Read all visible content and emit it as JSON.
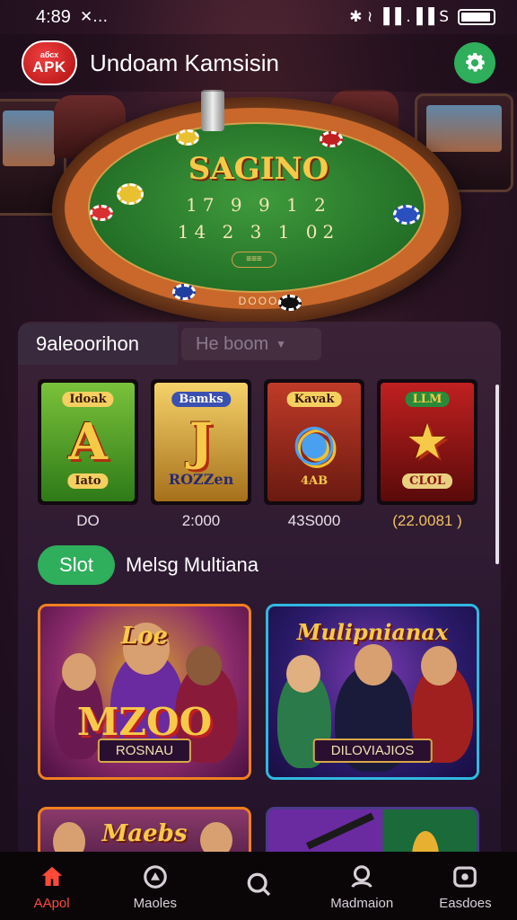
{
  "status_bar": {
    "time": "4:89",
    "left_icons": "✕…",
    "right_icons": "✱ ≀ ▐▐ .▐▐ S"
  },
  "header": {
    "logo_top": "абсх",
    "logo_bottom": "APK",
    "title": "Undoam Kamsisin",
    "settings_icon": "gear-icon"
  },
  "hero": {
    "table_title": "SAGINO",
    "row1": "17 9 9 1 2",
    "row2": "14 2 3 1 02",
    "pill": "≡≡≡",
    "bottom": "DOOO"
  },
  "panel": {
    "tab_active": "9aleoorihon",
    "search_placeholder": "He boom",
    "reels": [
      {
        "top": "Idoak",
        "big": "A",
        "bottom": "Iato",
        "value": "DO",
        "colors": [
          "#7ac23a",
          "#2e7a18"
        ]
      },
      {
        "top": "Bamks",
        "big": "J",
        "bottom": "ROZZen",
        "value": "2:000",
        "colors": [
          "#f5d26a",
          "#a6701a"
        ]
      },
      {
        "top": "Kavak",
        "big": "◉",
        "bottom": "4AB",
        "value": "43S000",
        "colors": [
          "#c03a28",
          "#6a1a10"
        ]
      },
      {
        "top": "LLM",
        "big": "★",
        "bottom": "CLOL",
        "value": "(22.0081 )",
        "colors": [
          "#c02020",
          "#5a0a0a"
        ]
      }
    ],
    "section_pill": "Slot",
    "section_title": "Melsg Multiana",
    "games": [
      {
        "title": "Loe",
        "big": "MZOO",
        "banner": "ROSNAU"
      },
      {
        "title": "Mulipnianax",
        "banner": "DILOVIAJIOS"
      },
      {
        "title": "Maebs"
      },
      {
        "title": ""
      }
    ]
  },
  "bottom_nav": {
    "items": [
      {
        "label": "AApol",
        "icon": "home-icon"
      },
      {
        "label": "Maoles",
        "icon": "play-icon"
      },
      {
        "label": "",
        "icon": "search-icon"
      },
      {
        "label": "Madmaion",
        "icon": "profile-icon"
      },
      {
        "label": "Easdoes",
        "icon": "wallet-icon"
      }
    ],
    "active_color": "#ff4a3a"
  },
  "colors": {
    "accent_green": "#2fae5c",
    "gold": "#f7c948",
    "background": "#2a1830"
  }
}
